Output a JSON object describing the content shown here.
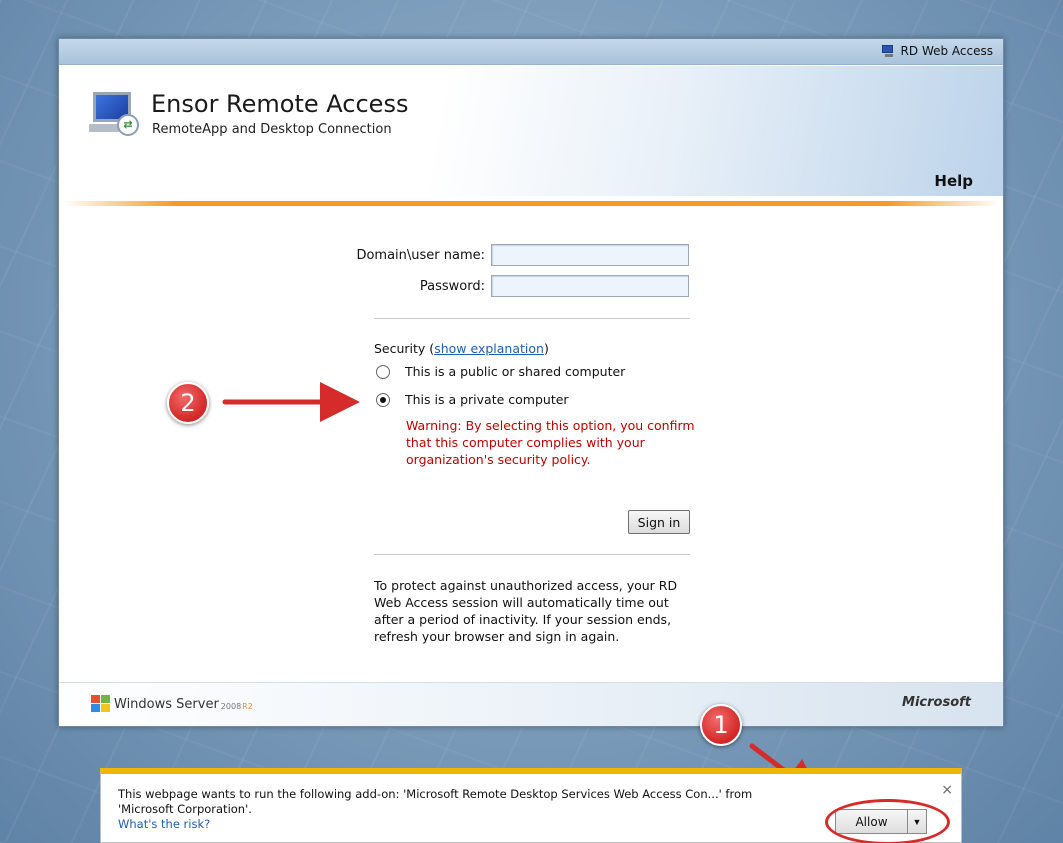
{
  "window": {
    "top_link": "RD Web Access",
    "title": "Ensor Remote Access",
    "subtitle": "RemoteApp and Desktop Connection",
    "help": "Help"
  },
  "form": {
    "username_label": "Domain\\user name:",
    "username_value": "",
    "password_label": "Password:",
    "password_value": "",
    "security_prefix": "Security (",
    "security_link": "show explanation",
    "security_suffix": ")",
    "options": [
      {
        "label": "This is a public or shared computer",
        "selected": false
      },
      {
        "label": "This is a private computer",
        "selected": true
      }
    ],
    "warning": "Warning: By selecting this option, you confirm that this computer complies with your organization's security policy.",
    "sign_in": "Sign in",
    "timeout_note": "To protect against unauthorized access, your RD Web Access session will automatically time out after a period of inactivity. If your session ends, refresh your browser and sign in again."
  },
  "footer": {
    "windows_server": "Windows Server",
    "version": "2008",
    "release": "R2",
    "microsoft": "Microsoft"
  },
  "annotations": {
    "badge_1": "1",
    "badge_2": "2",
    "accent_color": "#d62b2b"
  },
  "infobar": {
    "message": "This webpage wants to run the following add-on: 'Microsoft Remote Desktop Services Web Access Con...' from 'Microsoft Corporation'.",
    "risk_link": "What's the risk?",
    "allow": "Allow",
    "close": "×"
  }
}
